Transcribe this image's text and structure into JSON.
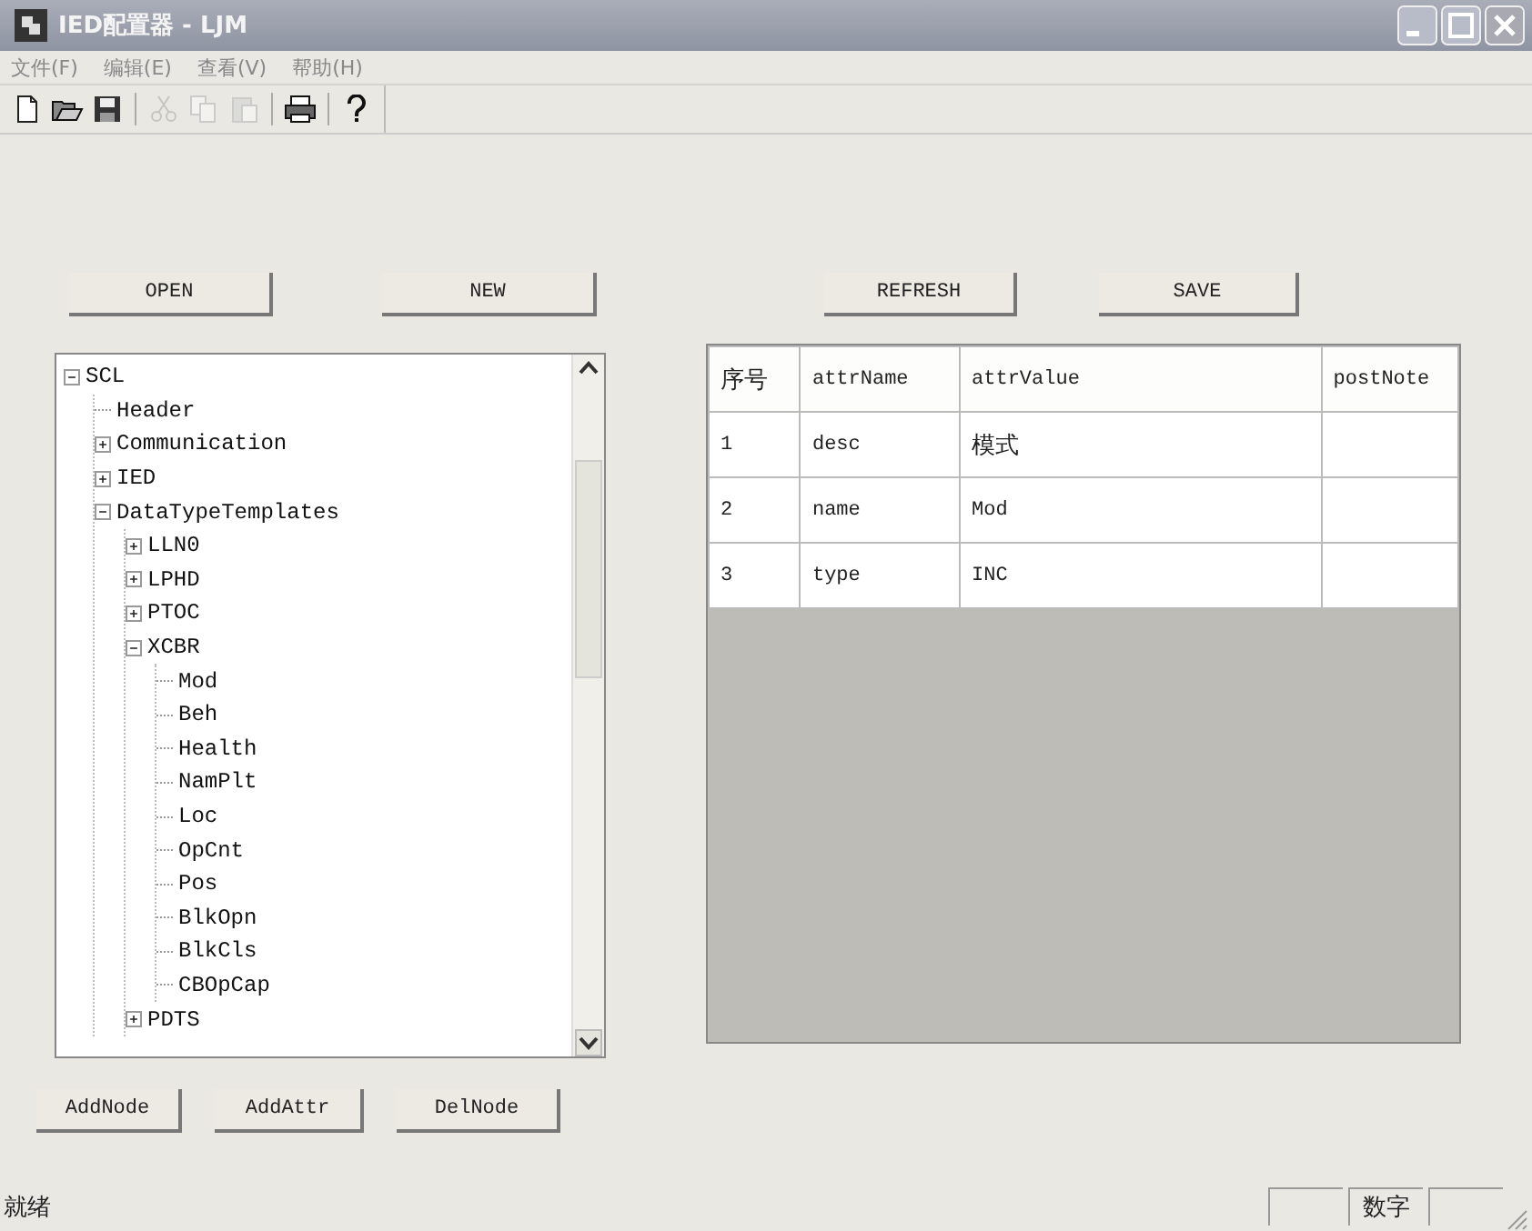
{
  "window": {
    "title": "IED配置器 - LJM"
  },
  "menu": [
    "文件(F)",
    "编辑(E)",
    "查看(V)",
    "帮助(H)"
  ],
  "toolbar": [
    {
      "kind": "new",
      "disabled": false
    },
    {
      "kind": "open",
      "disabled": false
    },
    {
      "kind": "save",
      "disabled": false
    },
    {
      "kind": "cut",
      "disabled": true
    },
    {
      "kind": "copy",
      "disabled": true
    },
    {
      "kind": "paste",
      "disabled": true
    },
    {
      "kind": "print",
      "disabled": false
    },
    {
      "kind": "help",
      "disabled": false
    }
  ],
  "top_buttons_left": [
    "OPEN",
    "NEW"
  ],
  "top_buttons_right": [
    "REFRESH",
    "SAVE"
  ],
  "tree": [
    {
      "label": "SCL",
      "expanded": true,
      "children": [
        {
          "label": "Header"
        },
        {
          "label": "Communication",
          "expanded": false
        },
        {
          "label": "IED",
          "expanded": false
        },
        {
          "label": "DataTypeTemplates",
          "expanded": true,
          "children": [
            {
              "label": "LLN0",
              "expanded": false
            },
            {
              "label": "LPHD",
              "expanded": false
            },
            {
              "label": "PTOC",
              "expanded": false
            },
            {
              "label": "XCBR",
              "expanded": true,
              "children": [
                {
                  "label": "Mod"
                },
                {
                  "label": "Beh"
                },
                {
                  "label": "Health"
                },
                {
                  "label": "NamPlt"
                },
                {
                  "label": "Loc"
                },
                {
                  "label": "OpCnt"
                },
                {
                  "label": "Pos"
                },
                {
                  "label": "BlkOpn"
                },
                {
                  "label": "BlkCls"
                },
                {
                  "label": "CBOpCap"
                }
              ]
            },
            {
              "label": "PDTS",
              "expanded": false
            }
          ]
        }
      ]
    }
  ],
  "table": {
    "columns": [
      "序号",
      "attrName",
      "attrValue",
      "postNote"
    ],
    "rows": [
      [
        "1",
        "desc",
        "模式",
        ""
      ],
      [
        "2",
        "name",
        "Mod",
        ""
      ],
      [
        "3",
        "type",
        "INC",
        ""
      ]
    ]
  },
  "bottom_buttons": [
    "AddNode",
    "AddAttr",
    "DelNode"
  ],
  "status_bar": {
    "text": "就绪",
    "indicator": "数字"
  }
}
